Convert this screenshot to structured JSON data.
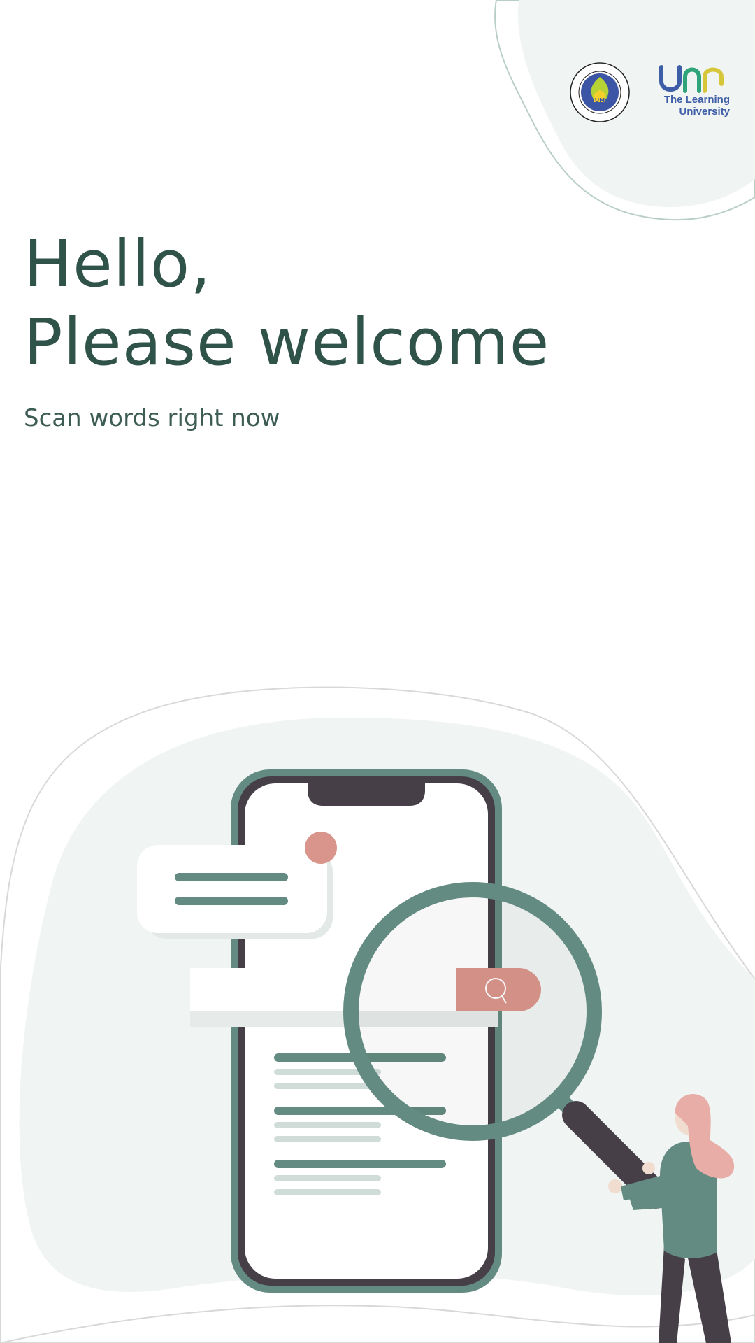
{
  "header": {
    "logo_seal_text": "UNIVERSITAS NEGERI MALANG",
    "logo_seal_initials": "UM",
    "brand_mark": "um",
    "brand_tagline_line1": "The Learning",
    "brand_tagline_line2": "University"
  },
  "welcome": {
    "greeting_line1": "Hello,",
    "greeting_line2": "Please welcome",
    "subtitle": "Scan words right now"
  },
  "colors": {
    "primary_text": "#2f5249",
    "accent_green": "#648b81",
    "accent_coral": "#d9958c",
    "phone_frame": "#463f47",
    "background_tint": "#f0f4f2"
  },
  "icons": {
    "search": "search-icon",
    "magnifier": "magnifying-glass-icon"
  }
}
